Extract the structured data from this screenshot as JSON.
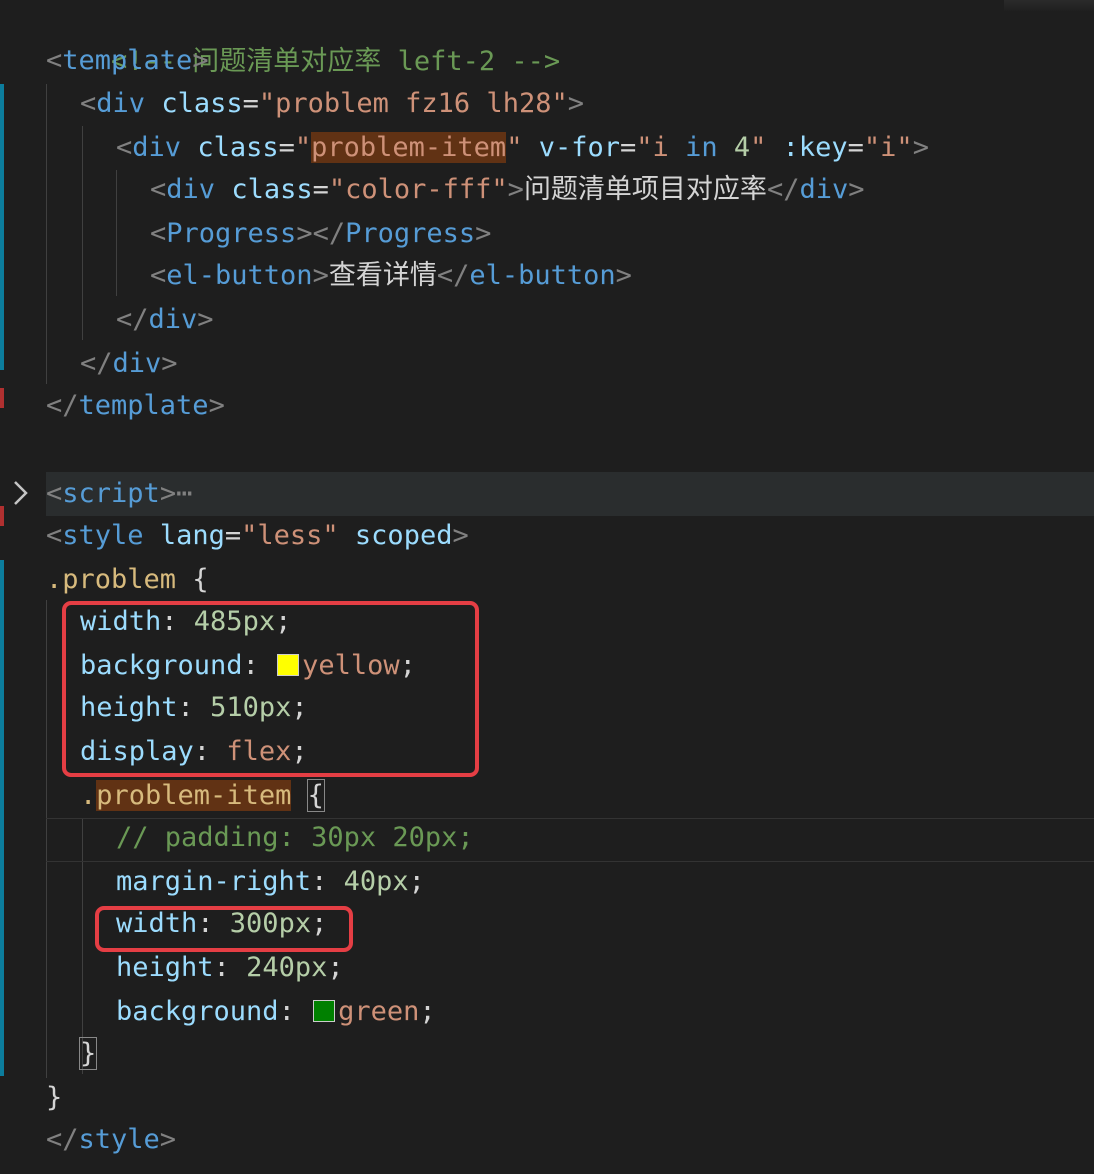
{
  "colors": {
    "background": "#1e1e1e",
    "highlight_box": "#e53e44",
    "swatch_yellow": "#ffff00",
    "swatch_green": "#008000",
    "gutter_modified": "#0c7d9d"
  },
  "icons": {
    "fold": "chevron-right-icon"
  },
  "code": {
    "l1": {
      "comment": "<!-- 问题清单对应率 left-2 -->"
    },
    "l2": {
      "tag": "template"
    },
    "l3": {
      "tag": "div",
      "attr": "class",
      "value": "\"problem fz16 lh28\""
    },
    "l4": {
      "tag": "div",
      "attr": "class",
      "value_q": "\"",
      "value_word": "problem-item",
      "value_q2": "\"",
      "attr2": "v-for",
      "value2_a": "\"i ",
      "value2_kw": "in",
      "value2_num": " 4",
      "value2_b": "\"",
      "attr3": ":key",
      "value3": "\"i\""
    },
    "l5": {
      "tag": "div",
      "attr": "class",
      "value": "\"color-fff\"",
      "text": "问题清单项目对应率",
      "close": "div"
    },
    "l6": {
      "tag": "Progress",
      "close": "Progress"
    },
    "l7": {
      "tag": "el-button",
      "text": "查看详情",
      "close": "el-button"
    },
    "l8": {
      "close": "div"
    },
    "l9": {
      "close": "div"
    },
    "l10": {
      "close": "template"
    },
    "l12": {
      "tag": "script",
      "ellipsis": "⋯"
    },
    "l13": {
      "tag": "style",
      "attr": "lang",
      "value": "\"less\"",
      "attr2": "scoped"
    },
    "l14": {
      "selector": ".problem",
      "brace": "{"
    },
    "l15": {
      "prop": "width",
      "num": "485px"
    },
    "l16": {
      "prop": "background",
      "val": "yellow"
    },
    "l17": {
      "prop": "height",
      "num": "510px"
    },
    "l18": {
      "prop": "display",
      "val": "flex"
    },
    "l19": {
      "selector": ".",
      "selector_word": "problem-item",
      "brace": "{"
    },
    "l20": {
      "comment": "// padding: 30px 20px;"
    },
    "l21": {
      "prop": "margin-right",
      "num": "40px"
    },
    "l22": {
      "prop": "width",
      "num": "300px"
    },
    "l23": {
      "prop": "height",
      "num": "240px"
    },
    "l24": {
      "prop": "background",
      "val": "green"
    },
    "l25": {
      "brace": "}"
    },
    "l26": {
      "brace": "}"
    },
    "l27": {
      "close": "style"
    }
  }
}
